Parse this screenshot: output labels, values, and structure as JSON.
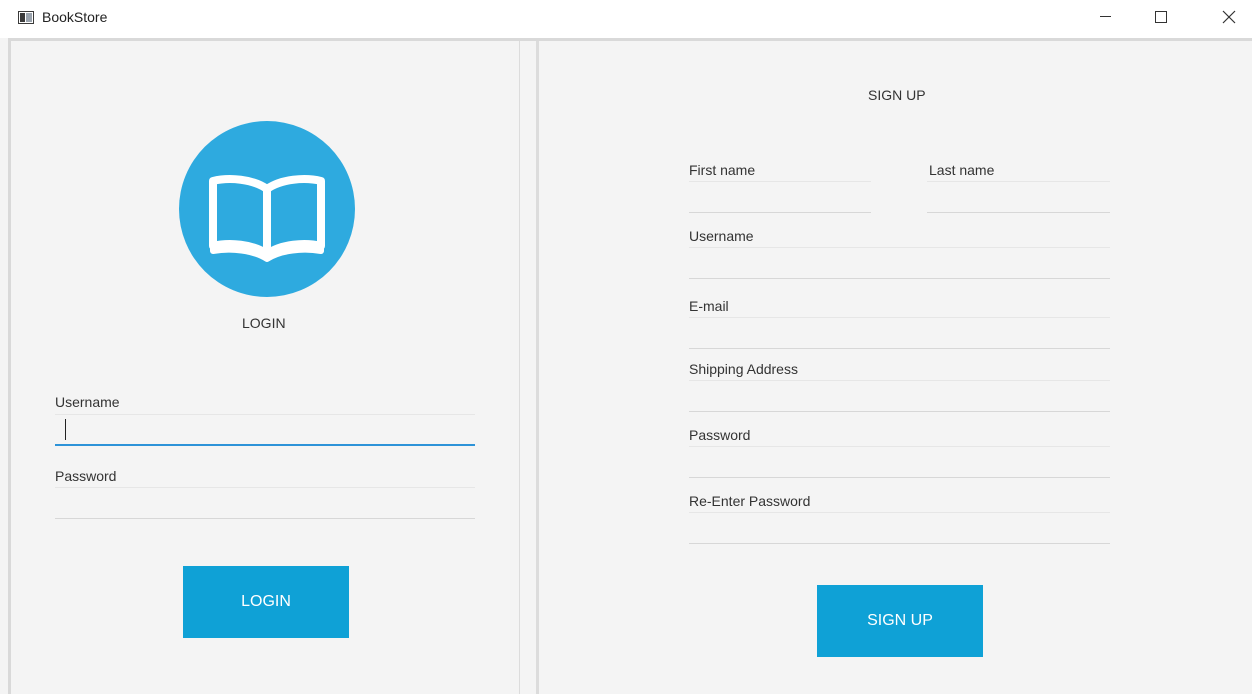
{
  "window": {
    "title": "BookStore",
    "icon": "app-window-icon",
    "controls": [
      "minimize-icon",
      "maximize-icon",
      "close-icon"
    ]
  },
  "login": {
    "logo_icon": "open-book-icon",
    "logo_color": "#2eaadf",
    "heading": "LOGIN",
    "username_label": "Username",
    "username_value": "",
    "password_label": "Password",
    "password_value": "",
    "button_label": "LOGIN",
    "focused_field": "username"
  },
  "signup": {
    "heading": "SIGN UP",
    "first_name_label": "First name",
    "last_name_label": "Last name",
    "username_label": "Username",
    "email_label": "E-mail",
    "address_label": "Shipping Address",
    "password_label": "Password",
    "reenter_password_label": "Re-Enter Password",
    "button_label": "SIGN UP"
  },
  "colors": {
    "accent": "#0fa1d6",
    "focus": "#2d93d8",
    "background": "#f4f4f4"
  }
}
